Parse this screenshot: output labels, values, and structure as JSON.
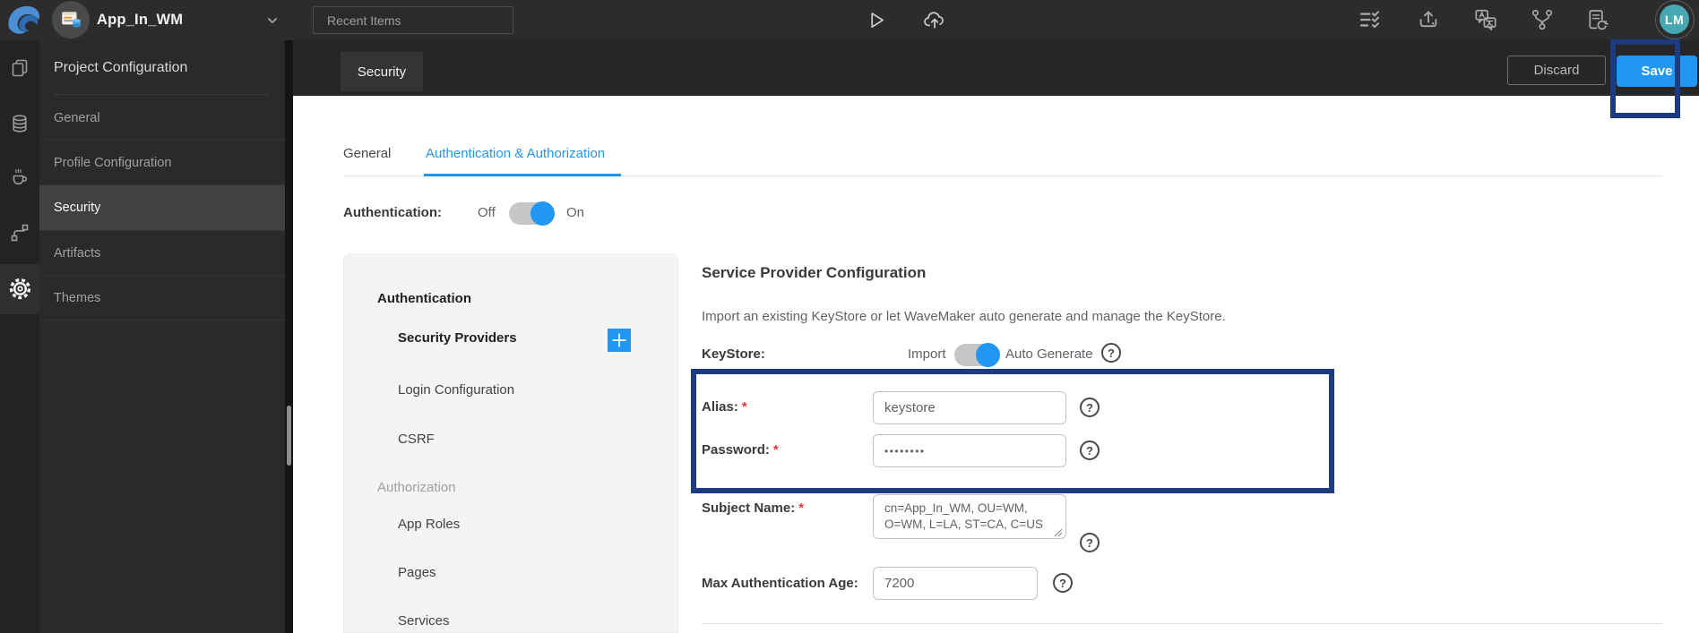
{
  "topbar": {
    "app_title": "App_In_WM",
    "recent_items_placeholder": "Recent Items",
    "avatar_initials": "LM"
  },
  "header": {
    "page_tab": "Security",
    "discard_label": "Discard",
    "save_label": "Save"
  },
  "sidebar": {
    "title": "Project Configuration",
    "items": [
      {
        "label": "General"
      },
      {
        "label": "Profile Configuration"
      },
      {
        "label": "Security"
      },
      {
        "label": "Artifacts"
      },
      {
        "label": "Themes"
      }
    ],
    "active_item": "Security"
  },
  "tabs": {
    "general": "General",
    "auth_authz": "Authentication & Authorization"
  },
  "auth_row": {
    "label": "Authentication:",
    "off": "Off",
    "on": "On",
    "state": "On"
  },
  "subnav": {
    "authentication_section": "Authentication",
    "security_providers": "Security Providers",
    "login_configuration": "Login Configuration",
    "csrf": "CSRF",
    "authorization_section": "Authorization",
    "app_roles": "App Roles",
    "pages": "Pages",
    "services": "Services",
    "active_item": "Security Providers"
  },
  "form": {
    "title": "Service Provider Configuration",
    "description": "Import an existing KeyStore or let WaveMaker auto generate and manage the KeyStore.",
    "keystore_label": "KeyStore:",
    "keystore_off_option": "Import",
    "keystore_on_option": "Auto Generate",
    "keystore_state": "Auto Generate",
    "alias_label": "Alias:",
    "alias_value": "keystore",
    "password_label": "Password:",
    "password_value": "••••••••",
    "subject_name_label": "Subject Name:",
    "subject_name_value": "cn=App_In_WM, OU=WM, O=WM, L=LA, ST=CA, C=US",
    "max_auth_age_label": "Max Authentication Age:",
    "max_auth_age_value": "7200",
    "required_mark": "*",
    "help_glyph": "?"
  },
  "colors": {
    "accent_blue": "#2196f3",
    "annotation_blue": "#1b3c80",
    "avatar_teal": "#47a8b2",
    "topbar_bg": "#2c2c2c",
    "panel_bg": "#2a2a2a",
    "card_bg": "#f4f4f4"
  }
}
